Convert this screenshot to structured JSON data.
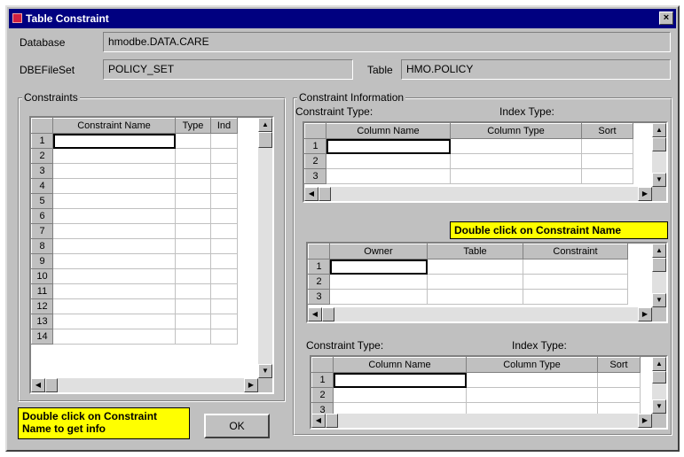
{
  "window": {
    "title": "Table Constraint",
    "close_glyph": "×"
  },
  "fields": {
    "database_label": "Database",
    "database_value": "hmodbe.DATA.CARE",
    "dbefileset_label": "DBEFileSet",
    "dbefileset_value": "POLICY_SET",
    "table_label": "Table",
    "table_value": "HMO.POLICY"
  },
  "constraints": {
    "group_title": "Constraints",
    "columns": [
      "Constraint Name",
      "Type",
      "Ind"
    ],
    "row_numbers": [
      "1",
      "2",
      "3",
      "4",
      "5",
      "6",
      "7",
      "8",
      "9",
      "10",
      "11",
      "12",
      "13",
      "14"
    ]
  },
  "info": {
    "group_title": "Constraint Information",
    "top": {
      "constraint_type_label": "Constraint Type:",
      "index_type_label": "Index Type:",
      "columns": [
        "Column Name",
        "Column Type",
        "Sort"
      ],
      "row_numbers": [
        "1",
        "2",
        "3"
      ]
    },
    "ref_note": "Double click on Constraint Name",
    "ref": {
      "columns": [
        "Owner",
        "Table",
        "Constraint"
      ],
      "row_numbers": [
        "1",
        "2",
        "3"
      ]
    },
    "bottom": {
      "constraint_type_label": "Constraint Type:",
      "index_type_label": "Index Type:",
      "columns": [
        "Column Name",
        "Column Type",
        "Sort"
      ],
      "row_numbers": [
        "1",
        "2",
        "3"
      ]
    }
  },
  "footer": {
    "note_line1": "Double click on Constraint",
    "note_line2": "Name to get info",
    "ok_label": "OK"
  },
  "colors": {
    "titlebar": "#000080",
    "dialog_face": "#c0c0c0",
    "note_bg": "#ffff00"
  },
  "icons": {
    "scroll_up": "up-arrow-icon",
    "scroll_down": "down-arrow-icon",
    "scroll_left": "left-arrow-icon",
    "scroll_right": "right-arrow-icon"
  }
}
